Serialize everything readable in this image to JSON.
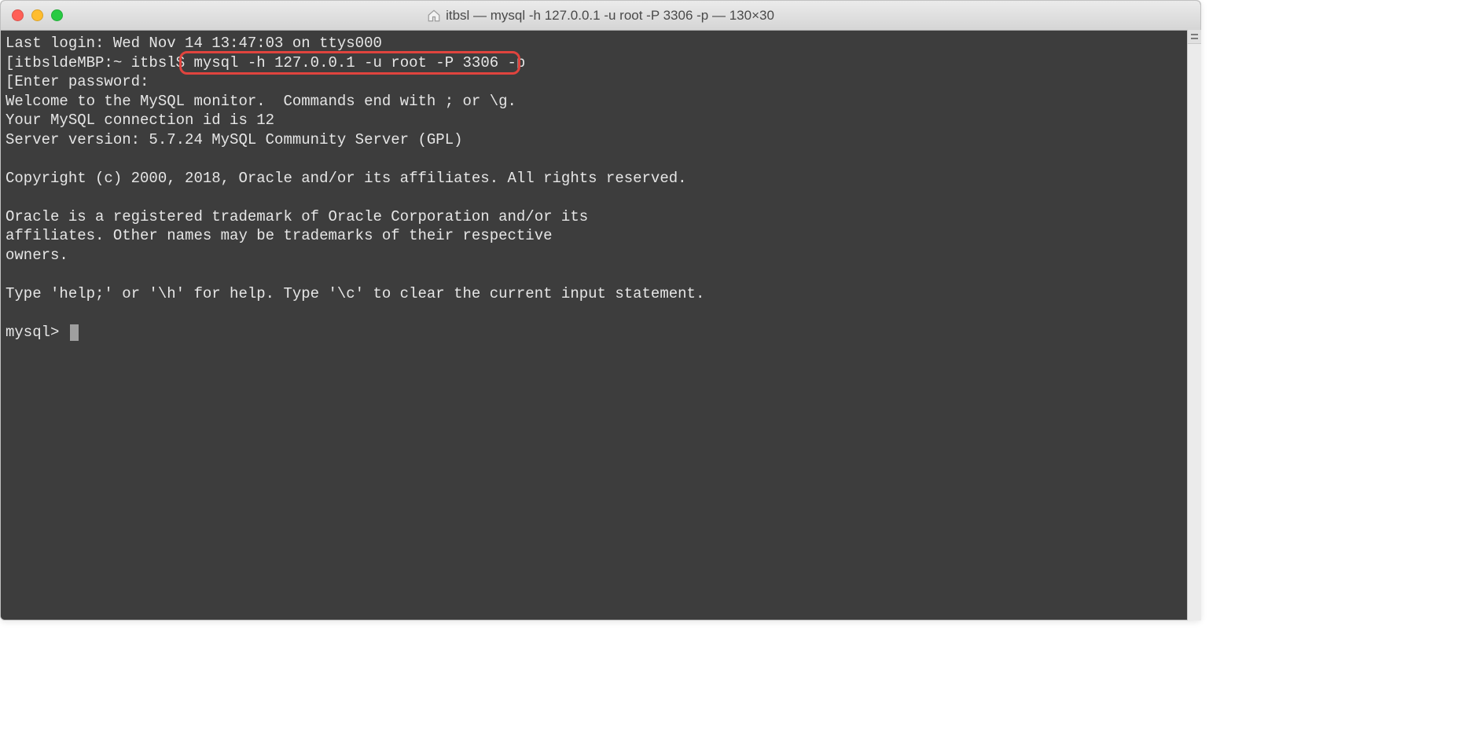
{
  "titlebar": {
    "title": "itbsl — mysql -h 127.0.0.1 -u root -P 3306 -p — 130×30"
  },
  "terminal": {
    "last_login": "Last login: Wed Nov 14 13:47:03 on ttys000",
    "prompt_prefix": "[itbsldeMBP:~ itbsl$ ",
    "command": "mysql -h 127.0.0.1 -u root -P 3306 -p",
    "enter_password": "[Enter password:",
    "welcome": "Welcome to the MySQL monitor.  Commands end with ; or \\g.",
    "conn_id": "Your MySQL connection id is 12",
    "server_version": "Server version: 5.7.24 MySQL Community Server (GPL)",
    "copyright": "Copyright (c) 2000, 2018, Oracle and/or its affiliates. All rights reserved.",
    "trademark1": "Oracle is a registered trademark of Oracle Corporation and/or its",
    "trademark2": "affiliates. Other names may be trademarks of their respective",
    "trademark3": "owners.",
    "help_line": "Type 'help;' or '\\h' for help. Type '\\c' to clear the current input statement.",
    "mysql_prompt": "mysql> ",
    "bracket": "]"
  }
}
